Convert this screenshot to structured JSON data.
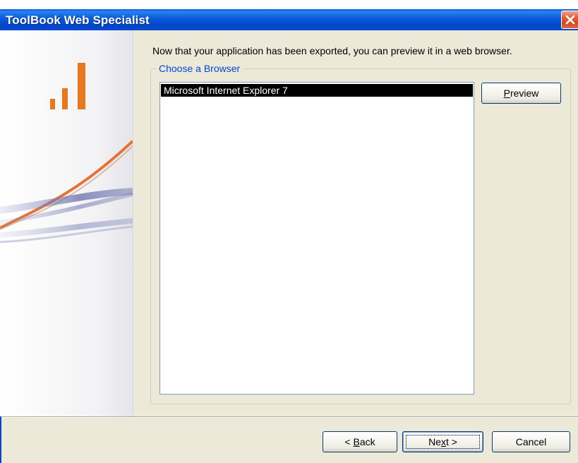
{
  "window": {
    "title": "ToolBook Web Specialist"
  },
  "instruction": "Now that your application has been exported, you can preview it in a web browser.",
  "group": {
    "legend": "Choose a Browser",
    "browsers": [
      "Microsoft Internet Explorer 7"
    ],
    "selected_index": 0,
    "preview": {
      "prefix": "",
      "accel": "P",
      "suffix": "review"
    }
  },
  "footer": {
    "back": {
      "prefix": "< ",
      "accel": "B",
      "suffix": "ack"
    },
    "next": {
      "prefix": "Ne",
      "accel": "x",
      "suffix": "t >"
    },
    "cancel": "Cancel"
  },
  "colors": {
    "titlebar": "#0054e3",
    "dialog_bg": "#ece9d8",
    "legend_text": "#0046d5",
    "logo_orange": "#e8781e"
  },
  "icons": {
    "close": "close-icon",
    "logo": "toolbook-logo"
  }
}
